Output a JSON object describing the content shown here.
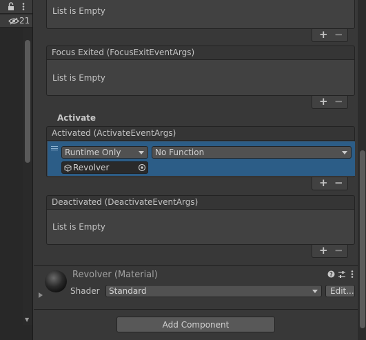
{
  "hierarchy": {
    "hidden_count": "21"
  },
  "events": {
    "top_empty_label": "List is Empty",
    "focus_exited": {
      "title": "Focus Exited (FocusExitEventArgs)",
      "empty_label": "List is Empty"
    },
    "activate_section_title": "Activate",
    "activated": {
      "title": "Activated (ActivateEventArgs)",
      "entry": {
        "call_state": "Runtime Only",
        "function": "No Function",
        "target_object": "Revolver"
      }
    },
    "deactivated": {
      "title": "Deactivated (DeactivateEventArgs)",
      "empty_label": "List is Empty"
    },
    "add_symbol": "+",
    "remove_symbol": "−"
  },
  "material": {
    "title": "Revolver (Material)",
    "shader_label": "Shader",
    "shader_value": "Standard",
    "edit_label": "Edit..."
  },
  "add_component_label": "Add Component",
  "colors": {
    "selection": "#2c5d87",
    "panel": "#383838",
    "box": "#414141"
  }
}
